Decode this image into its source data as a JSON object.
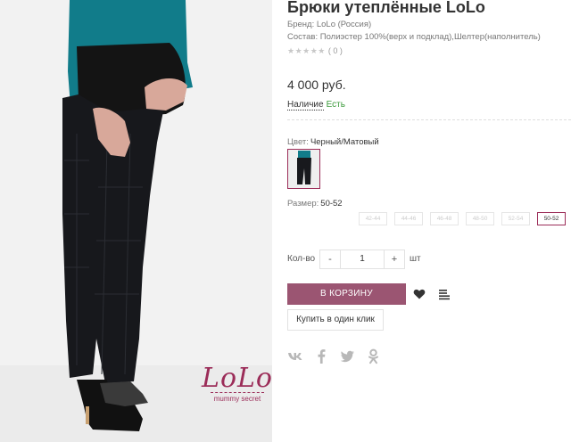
{
  "product": {
    "title": "Брюки утеплённые LoLo",
    "brand": "Бренд: LoLo (Россия)",
    "composition": "Состав: Полиэстер 100%(верх и подклад),Шелтер(наполнитель)",
    "rating_stars": "★★★★★",
    "rating_count": "( 0 )",
    "price": "4 000 руб."
  },
  "availability": {
    "label": "Наличие",
    "value": "Есть",
    "value_color": "#3a9a3a"
  },
  "color": {
    "label": "Цвет:",
    "value": "Черный/Матовый"
  },
  "size": {
    "label": "Размер:",
    "value": "50-52",
    "options": [
      "42-44",
      "44-46",
      "46-48",
      "48-50",
      "52-54",
      "50-52"
    ],
    "selected_index": 5
  },
  "quantity": {
    "label": "Кол-во",
    "minus": "-",
    "value": "1",
    "plus": "+",
    "unit": "шт"
  },
  "actions": {
    "cart_label": "В КОРЗИНУ",
    "one_click_label": "Купить в один клик",
    "favorite_icon": "heart-icon",
    "compare_icon": "compare-list-icon"
  },
  "share": {
    "icons": [
      "vk-icon",
      "facebook-icon",
      "twitter-icon",
      "odnoklassniki-icon"
    ]
  },
  "photo_logo": {
    "word": "LoLo",
    "sub": "mummy secret"
  },
  "colors": {
    "accent": "#9b2c58",
    "button": "#9b5572",
    "in_stock": "#3a9a3a",
    "muted": "#777777"
  }
}
